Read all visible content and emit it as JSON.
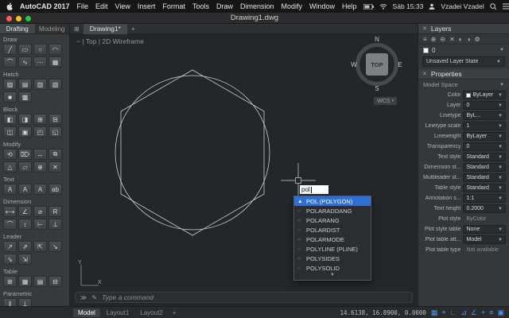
{
  "menu_bar": {
    "items": [
      "AutoCAD 2017",
      "File",
      "Edit",
      "View",
      "Insert",
      "Format",
      "Tools",
      "Draw",
      "Dimension",
      "Modify",
      "Window",
      "Help"
    ],
    "time": "Sáb 15:33",
    "user": "Vzadei Vzadel"
  },
  "window": {
    "title": "Drawing1.dwg"
  },
  "palette": {
    "tabs": [
      {
        "label": "Drafting",
        "active": true
      },
      {
        "label": "Modeling",
        "active": false
      }
    ],
    "sections": [
      {
        "name": "Draw",
        "glyphs": [
          "╱",
          "▭",
          "○",
          "◠",
          "⌒",
          "∿",
          "⋯",
          "▦"
        ]
      },
      {
        "name": "Hatch",
        "glyphs": [
          "▨",
          "▤",
          "▥",
          "▧",
          "■",
          "▩"
        ]
      },
      {
        "name": "Block",
        "glyphs": [
          "◧",
          "◨",
          "⊞",
          "⊟",
          "◫",
          "▣",
          "◰",
          "◱"
        ]
      },
      {
        "name": "Modify",
        "glyphs": [
          "⟲",
          "⌦",
          "↔",
          "⧉",
          "△",
          "▱",
          "⊕",
          "✕"
        ]
      },
      {
        "name": "Text",
        "glyphs": [
          "A",
          "A",
          "A",
          "ab"
        ]
      },
      {
        "name": "Dimension",
        "glyphs": [
          "⟷",
          "∠",
          "⌀",
          "R",
          "⌒",
          "↕",
          "⊢",
          "⊥"
        ]
      },
      {
        "name": "Leader",
        "glyphs": [
          "↗",
          "⇗",
          "⇱",
          "↘",
          "⇘",
          "⇲"
        ]
      },
      {
        "name": "Table",
        "glyphs": [
          "⊞",
          "▦",
          "▤",
          "⊟"
        ]
      },
      {
        "name": "Parametric",
        "glyphs": [
          "∥",
          "⊥"
        ]
      }
    ]
  },
  "canvas": {
    "file_tab": "Drawing1*",
    "viewport_label": "Top | 2D Wireframe",
    "viewcube": {
      "north": "N",
      "south": "S",
      "east": "E",
      "west": "W",
      "face": "TOP",
      "wcs": "WCS"
    },
    "command_input": "pol",
    "autocomplete": [
      {
        "label": "POL (POLYGON)",
        "selected": true
      },
      {
        "label": "POLARADDANG",
        "selected": false
      },
      {
        "label": "POLARANG",
        "selected": false
      },
      {
        "label": "POLARDIST",
        "selected": false
      },
      {
        "label": "POLARMODE",
        "selected": false
      },
      {
        "label": "POLYLINE (PLINE)",
        "selected": false
      },
      {
        "label": "POLYSIDES",
        "selected": false
      },
      {
        "label": "POLYSOLID",
        "selected": false
      }
    ],
    "command_hint": "Type a command"
  },
  "status_bar": {
    "tabs": [
      {
        "label": "Model",
        "active": true
      },
      {
        "label": "Layout1",
        "active": false
      },
      {
        "label": "Layout2",
        "active": false
      }
    ],
    "coordinates": "14.6138, 16.8900, 0.0000",
    "icons": [
      "▦",
      "⌖",
      "∟",
      "⊿",
      "∠",
      "+",
      "≡",
      "▣"
    ]
  },
  "layers_panel": {
    "title": "Layers",
    "icons": [
      "≡",
      "⊕",
      "⊖",
      "✕",
      "◐",
      "◑",
      "⚙"
    ],
    "current_layer": "0",
    "layer_state": "Unsaved Layer State"
  },
  "properties_panel": {
    "title": "Properties",
    "space": "Model Space",
    "rows": [
      {
        "label": "Color",
        "value": "ByLayer",
        "swatch": true
      },
      {
        "label": "Layer",
        "value": "0"
      },
      {
        "label": "Linetype",
        "value": "ByL..."
      },
      {
        "label": "Linetype scale",
        "value": "1"
      },
      {
        "label": "Lineweight",
        "value": "ByLayer"
      },
      {
        "label": "Transparency",
        "value": "0"
      },
      {
        "label": "Text style",
        "value": "Standard"
      },
      {
        "label": "Dimension st...",
        "value": "Standard"
      },
      {
        "label": "Multileader st...",
        "value": "Standard"
      },
      {
        "label": "Table style",
        "value": "Standard"
      },
      {
        "label": "Annotation s...",
        "value": "1:1"
      },
      {
        "label": "Text height",
        "value": "0.2000"
      },
      {
        "label": "Plot style",
        "value": "ByColor",
        "grayed": true
      },
      {
        "label": "Plot style table",
        "value": "None"
      },
      {
        "label": "Plot table att...",
        "value": "Model"
      },
      {
        "label": "Plot table type",
        "value": "Not available",
        "grayed": true
      }
    ]
  },
  "colors": {
    "accent": "#2f6fd6",
    "canvas_bg": "#24272a",
    "panel_bg": "#35383b"
  }
}
